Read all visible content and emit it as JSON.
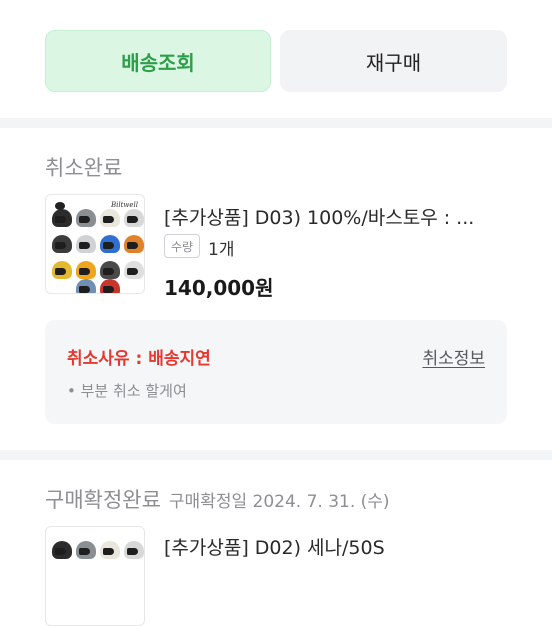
{
  "actions": {
    "track_label": "배송조회",
    "rebuy_label": "재구매"
  },
  "sections": [
    {
      "status": "취소완료",
      "product": {
        "name": "[추가상품] D03) 100%/바스토우 : ...",
        "qty_label": "수량",
        "qty_value": "1개",
        "price": "140,000원"
      },
      "cancel": {
        "reason": "취소사유 : 배송지연",
        "info_link": "취소정보",
        "note": "• 부분 취소 할게여"
      }
    },
    {
      "status": "구매확정완료",
      "status_sub": "구매확정일 2024. 7. 31. (수)",
      "product": {
        "name": "[추가상품] D02) 세나/50S"
      }
    }
  ],
  "thumbnail": {
    "brand": "Biltwell",
    "helmet_colors": [
      "#2c2c2c",
      "#8a8f94",
      "#e9e6dc",
      "#d8d8d8",
      "#3b3b3b",
      "#cfd3d6",
      "#2f6fd0",
      "#e0822b",
      "#e2b92f",
      "#f0a51f",
      "#4a4a4a",
      "#dedede",
      "#6f8fb3",
      "#c9342c"
    ]
  }
}
